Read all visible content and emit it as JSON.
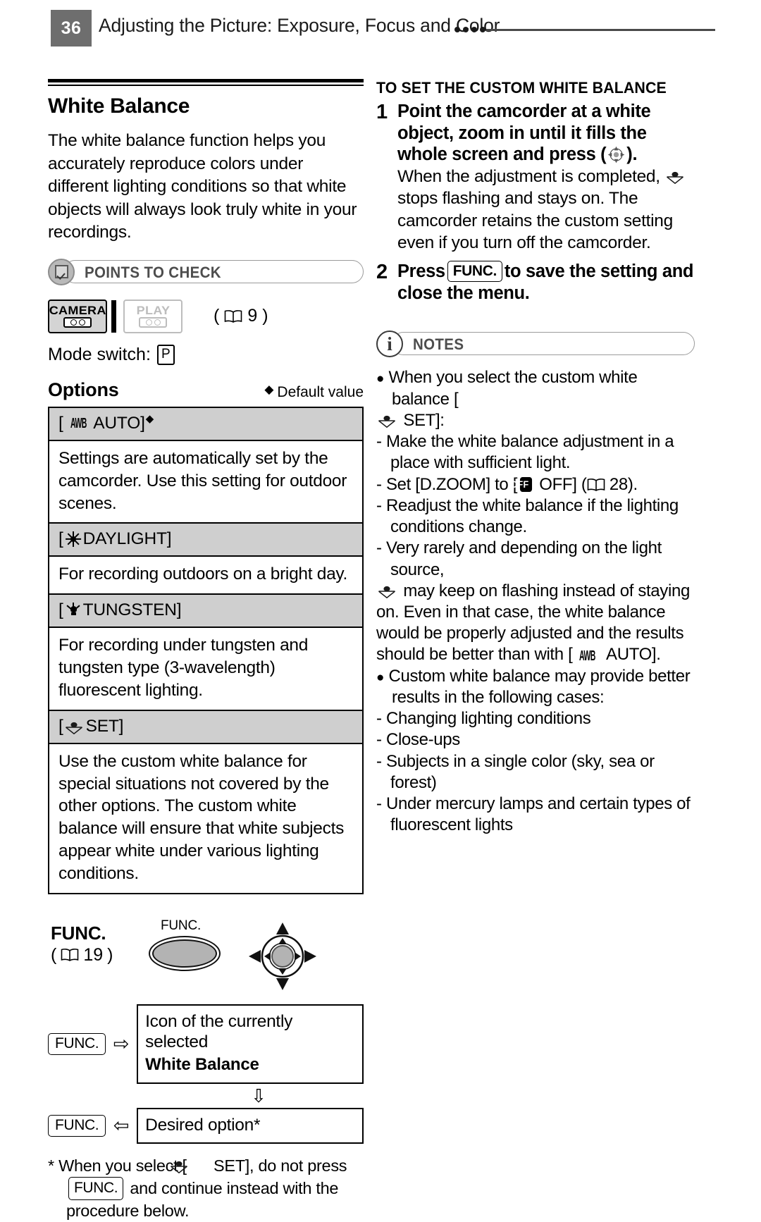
{
  "header": {
    "page_number": "36",
    "title": "Adjusting the Picture: Exposure, Focus and Color",
    "badge_color": "#6e6e6e"
  },
  "left": {
    "section_title": "White Balance",
    "intro": "The white balance function helps you accurately reproduce colors under different lighting conditions so that white objects will always look truly white in your recordings.",
    "points_to_check": {
      "label": "POINTS TO CHECK",
      "icon": "checkbox-icon"
    },
    "modes": {
      "camera_label": "CAMERA",
      "play_label": "PLAY",
      "page_ref": "9",
      "mode_switch_label": "Mode switch:",
      "mode_switch_value": "P"
    },
    "options_heading": "Options",
    "default_value_note": "Default value",
    "options_table": [
      {
        "option": "[ AWB AUTO]",
        "icon": "awb-icon",
        "is_default": true,
        "description": "Settings are automatically set by the camcorder. Use this setting for outdoor scenes."
      },
      {
        "option": "[ DAYLIGHT]",
        "icon": "sun-icon",
        "is_default": false,
        "description": "For recording outdoors on a bright day."
      },
      {
        "option": "[ TUNGSTEN]",
        "icon": "bulb-icon",
        "is_default": false,
        "description": "For recording under tungsten and tungsten type (3-wavelength) fluorescent lighting."
      },
      {
        "option": "[ SET]",
        "icon": "custom-wb-icon",
        "is_default": false,
        "description": "Use the custom white balance for special situations not covered by the other options. The custom white balance will ensure that white subjects appear white under various lighting conditions."
      }
    ],
    "func_diagram": {
      "title": "FUNC.",
      "page_ref": "19",
      "button_caption": "FUNC.",
      "key_label": "FUNC.",
      "step1_line1": "Icon of the currently selected",
      "step1_line2": "White Balance",
      "step2_text": "Desired option*",
      "arrow_right": "⇨",
      "arrow_left": "⇦",
      "arrow_down": "⇩"
    },
    "footnote": {
      "prefix": "* When you select [",
      "set_label": " SET], do not press",
      "key": "FUNC.",
      "line2_rest": " and continue instead with the",
      "line3": "procedure below."
    }
  },
  "right": {
    "subheading": "TO SET THE CUSTOM WHITE BALANCE",
    "steps": [
      {
        "number": "1",
        "bold_a": "Point the camcorder at a white object, zoom in until it fills the whole screen and press (",
        "bold_b": ").",
        "regular_a": "When the adjustment is completed,",
        "regular_b": "stops flashing and stays on. The camcorder retains the custom setting even if you turn off the camcorder."
      },
      {
        "number": "2",
        "bold_a": "Press",
        "key": "FUNC.",
        "bold_b": "to save the setting and close the menu."
      }
    ],
    "notes": {
      "label": "NOTES",
      "icon": "info-icon",
      "items": [
        {
          "type": "bullet",
          "text": "When you select the custom white balance ["
        },
        {
          "type": "cont",
          "text": " SET]:"
        },
        {
          "type": "dash",
          "text": "Make the white balance adjustment in a place with sufficient light."
        },
        {
          "type": "dash-off",
          "a": "Set [D.ZOOM] to [",
          "off": "OFF",
          "b": " OFF] (",
          "page": "28",
          "c": ")."
        },
        {
          "type": "dash",
          "text": "Readjust the white balance if the lighting conditions change."
        },
        {
          "type": "dash",
          "text": "Very rarely and depending on the light source,"
        },
        {
          "type": "cont-icon",
          "text": "may keep on flashing instead of staying on. Even in that case, the white balance would be properly adjusted and the results should be better than with ["
        },
        {
          "type": "cont-awb",
          "text": " AUTO]."
        },
        {
          "type": "bullet",
          "text": "Custom white balance may provide better results in the following cases:"
        },
        {
          "type": "dash",
          "text": "Changing lighting conditions"
        },
        {
          "type": "dash",
          "text": "Close-ups"
        },
        {
          "type": "dash",
          "text": "Subjects in a single color (sky, sea or forest)"
        },
        {
          "type": "dash",
          "text": "Under mercury lamps and certain types of fluorescent lights"
        }
      ]
    }
  }
}
